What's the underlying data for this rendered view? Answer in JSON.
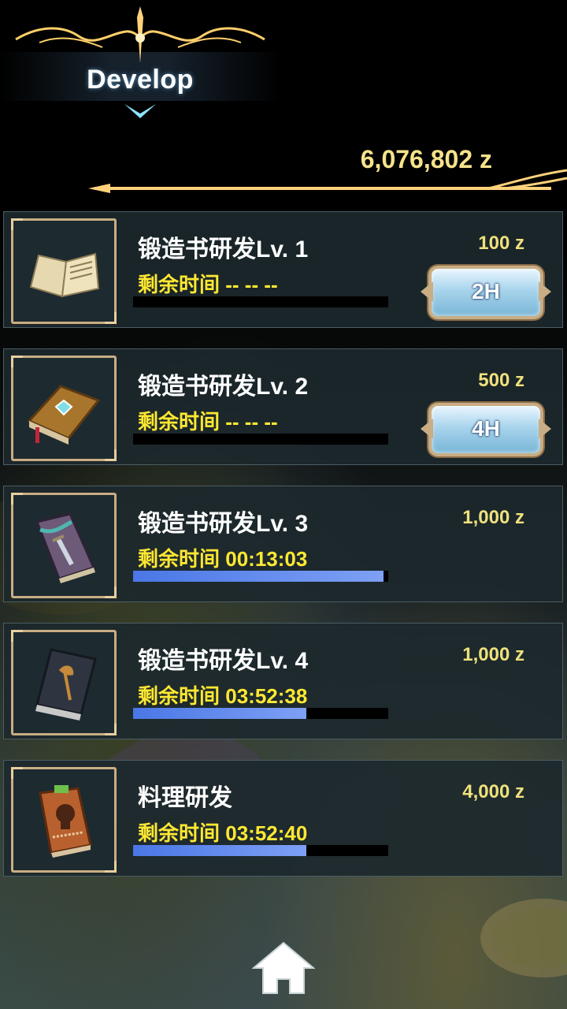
{
  "header": {
    "title": "Develop"
  },
  "currency": {
    "amount": "6,076,802 z"
  },
  "items": [
    {
      "name": "锻造书研发Lv. 1",
      "time_label": "剩余时间",
      "time_value": "-- -- --",
      "price": "100 z",
      "progress": 0,
      "button": "2H",
      "icon": "old-paper-book-icon"
    },
    {
      "name": "锻造书研发Lv. 2",
      "time_label": "剩余时间",
      "time_value": "-- -- --",
      "price": "500 z",
      "progress": 0,
      "button": "4H",
      "icon": "leather-gem-book-icon"
    },
    {
      "name": "锻造书研发Lv. 3",
      "time_label": "剩余时间",
      "time_value": "00:13:03",
      "price": "1,000 z",
      "progress": 0.98,
      "button": null,
      "icon": "sword-book-icon"
    },
    {
      "name": "锻造书研发Lv. 4",
      "time_label": "剩余时间",
      "time_value": "03:52:38",
      "price": "1,000 z",
      "progress": 0.68,
      "button": null,
      "icon": "axe-book-icon"
    },
    {
      "name": "料理研发",
      "time_label": "剩余时间",
      "time_value": "03:52:40",
      "price": "4,000 z",
      "progress": 0.68,
      "button": null,
      "icon": "cooking-book-icon"
    }
  ],
  "nav": {
    "home_icon": "home-icon"
  },
  "colors": {
    "accent_gold": "#f6e28a",
    "time_yellow": "#ffe832",
    "progress_blue": "#4a77e6"
  }
}
